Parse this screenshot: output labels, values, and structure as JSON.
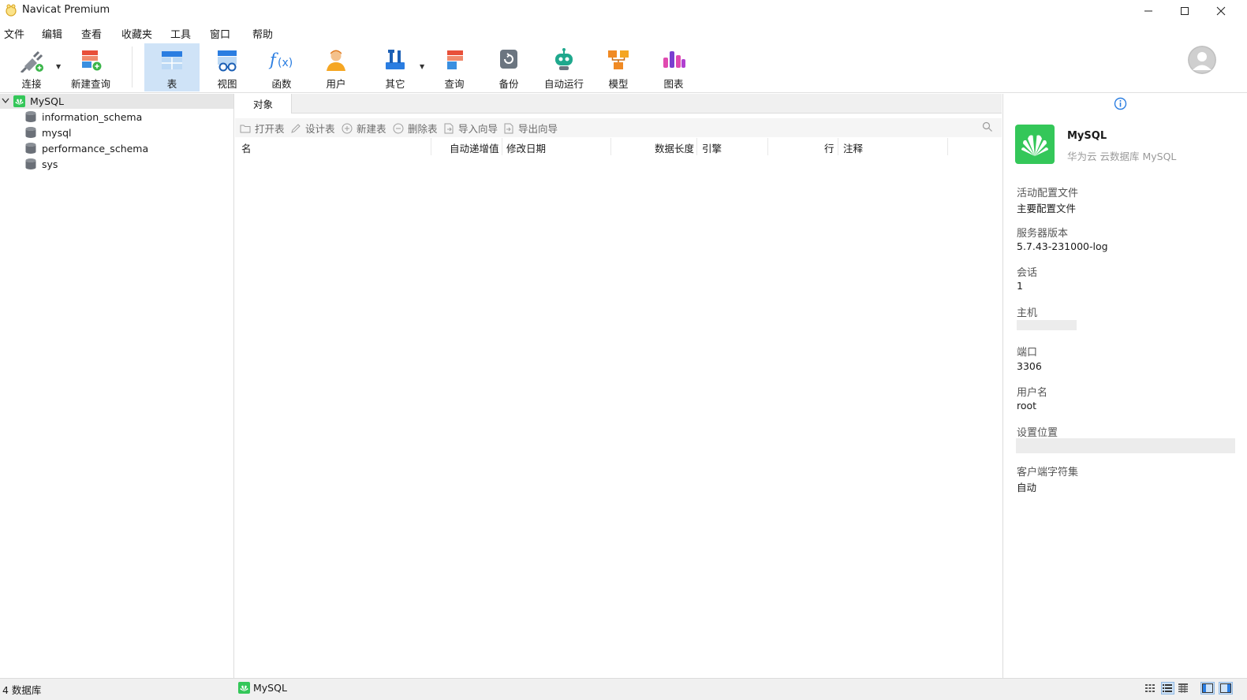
{
  "app": {
    "title": "Navicat Premium"
  },
  "menu": [
    "文件",
    "编辑",
    "查看",
    "收藏夹",
    "工具",
    "窗口",
    "帮助"
  ],
  "toolbar": {
    "connect": "连接",
    "new_query": "新建查询",
    "table": "表",
    "view": "视图",
    "function": "函数",
    "user": "用户",
    "other": "其它",
    "query": "查询",
    "backup": "备份",
    "automation": "自动运行",
    "model": "模型",
    "chart": "图表"
  },
  "sidebar": {
    "connection": "MySQL",
    "databases": [
      "information_schema",
      "mysql",
      "performance_schema",
      "sys"
    ]
  },
  "main": {
    "tab": "对象",
    "actions": {
      "open_table": "打开表",
      "design_table": "设计表",
      "new_table": "新建表",
      "delete_table": "删除表",
      "import_wizard": "导入向导",
      "export_wizard": "导出向导"
    },
    "columns": [
      "名",
      "自动递增值",
      "修改日期",
      "数据长度",
      "引擎",
      "行",
      "注释"
    ]
  },
  "info": {
    "name": "MySQL",
    "subtitle": "华为云 云数据库 MySQL",
    "fields": [
      {
        "label": "活动配置文件",
        "value": "主要配置文件"
      },
      {
        "label": "服务器版本",
        "value": "5.7.43-231000-log"
      },
      {
        "label": "会话",
        "value": "1"
      },
      {
        "label": "主机",
        "value": ""
      },
      {
        "label": "端口",
        "value": "3306"
      },
      {
        "label": "用户名",
        "value": "root"
      },
      {
        "label": "设置位置",
        "value": ""
      },
      {
        "label": "客户端字符集",
        "value": "自动"
      }
    ]
  },
  "status": {
    "db_count": "4 数据库",
    "connection": "MySQL"
  },
  "colors": {
    "accent": "#2a7de1",
    "active_tool_bg": "#cfe3f7",
    "huawei_green": "#34c759"
  }
}
